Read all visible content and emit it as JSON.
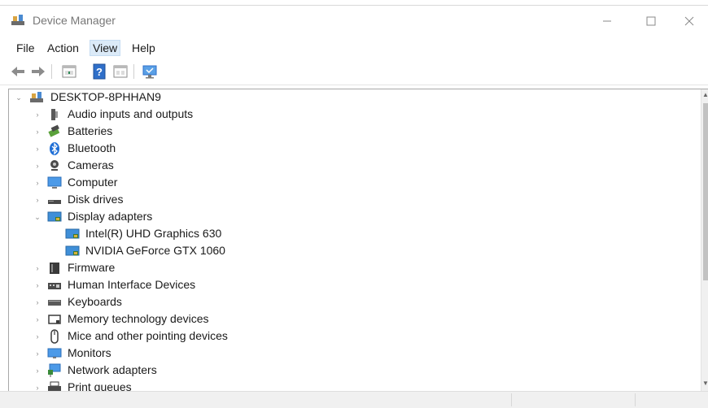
{
  "window": {
    "title": "Device Manager"
  },
  "menu": [
    {
      "label": "File"
    },
    {
      "label": "Action"
    },
    {
      "label": "View"
    },
    {
      "label": "Help"
    }
  ],
  "toolbar": [
    "back-arrow-icon",
    "forward-arrow-icon",
    "properties-icon",
    "help-icon",
    "view-icon",
    "monitor-scan-icon"
  ],
  "tree": {
    "root": "DESKTOP-8PHHAN9",
    "categories": [
      {
        "label": "Audio inputs and outputs",
        "icon": "speaker-icon",
        "expanded": false
      },
      {
        "label": "Batteries",
        "icon": "battery-icon",
        "expanded": false
      },
      {
        "label": "Bluetooth",
        "icon": "bluetooth-icon",
        "expanded": false
      },
      {
        "label": "Cameras",
        "icon": "camera-icon",
        "expanded": false
      },
      {
        "label": "Computer",
        "icon": "computer-icon",
        "expanded": false
      },
      {
        "label": "Disk drives",
        "icon": "disk-drive-icon",
        "expanded": false
      },
      {
        "label": "Display adapters",
        "icon": "display-adapter-icon",
        "expanded": true,
        "children": [
          {
            "label": "Intel(R) UHD Graphics 630",
            "icon": "display-adapter-icon"
          },
          {
            "label": "NVIDIA GeForce GTX 1060",
            "icon": "display-adapter-icon"
          }
        ]
      },
      {
        "label": "Firmware",
        "icon": "firmware-icon",
        "expanded": false
      },
      {
        "label": "Human Interface Devices",
        "icon": "hid-icon",
        "expanded": false
      },
      {
        "label": "Keyboards",
        "icon": "keyboard-icon",
        "expanded": false
      },
      {
        "label": "Memory technology devices",
        "icon": "memory-icon",
        "expanded": false
      },
      {
        "label": "Mice and other pointing devices",
        "icon": "mouse-icon",
        "expanded": false
      },
      {
        "label": "Monitors",
        "icon": "monitor-icon",
        "expanded": false
      },
      {
        "label": "Network adapters",
        "icon": "network-adapter-icon",
        "expanded": false
      },
      {
        "label": "Print queues",
        "icon": "printer-icon",
        "expanded": false
      }
    ]
  }
}
